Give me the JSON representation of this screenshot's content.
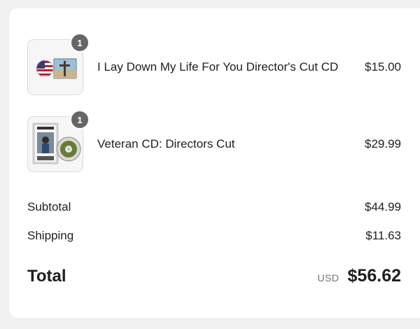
{
  "items": [
    {
      "name": "I Lay Down My Life For You Director's Cut CD",
      "price": "$15.00",
      "quantity": "1",
      "thumbnail_icon": "flag-cross-cd-icon"
    },
    {
      "name": "Veteran CD: Directors Cut",
      "price": "$29.99",
      "quantity": "1",
      "thumbnail_icon": "dvd-case-disc-icon"
    }
  ],
  "summary": {
    "subtotal_label": "Subtotal",
    "subtotal_value": "$44.99",
    "shipping_label": "Shipping",
    "shipping_value": "$11.63",
    "total_label": "Total",
    "currency": "USD",
    "total_value": "$56.62"
  },
  "colors": {
    "badge": "#666666",
    "page_background": "#f0f0f0",
    "card_background": "#ffffff"
  }
}
